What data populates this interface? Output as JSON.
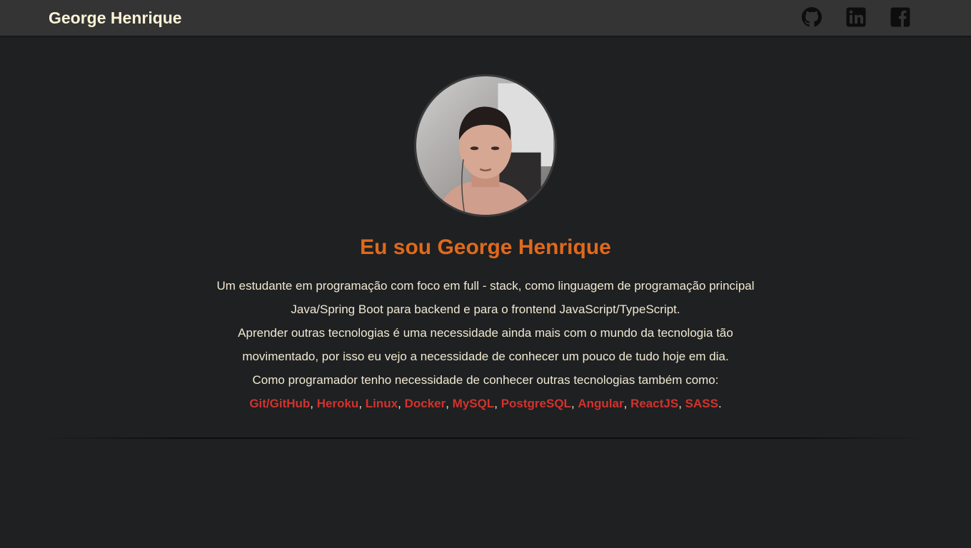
{
  "navbar": {
    "brand": "George Henrique",
    "links": [
      {
        "icon": "github-icon"
      },
      {
        "icon": "linkedin-icon"
      },
      {
        "icon": "facebook-icon"
      }
    ]
  },
  "profile": {
    "heading": "Eu sou George Henrique",
    "bio_lines": [
      "Um estudante em programação com foco em full - stack, como linguagem de programação principal",
      "Java/Spring Boot para backend e para o frontend JavaScript/TypeScript.",
      "Aprender outras tecnologias é uma necessidade ainda mais com o mundo da tecnologia tão",
      "movimentado, por isso eu vejo a necessidade de conhecer um pouco de tudo hoje em dia.",
      "Como programador tenho necessidade de conhecer outras tecnologias também como:"
    ],
    "techs": [
      "Git/GitHub",
      "Heroku",
      "Linux",
      "Docker",
      "MySQL",
      "PostgreSQL",
      "Angular",
      "ReactJS",
      "SASS"
    ],
    "tech_separator": ", ",
    "tech_end": "."
  },
  "colors": {
    "background": "#1e2022",
    "navbar": "#343434",
    "brand": "#fdf2d6",
    "heading": "#e0691b",
    "text": "#f1e8d0",
    "tech_link": "#d3322c"
  }
}
